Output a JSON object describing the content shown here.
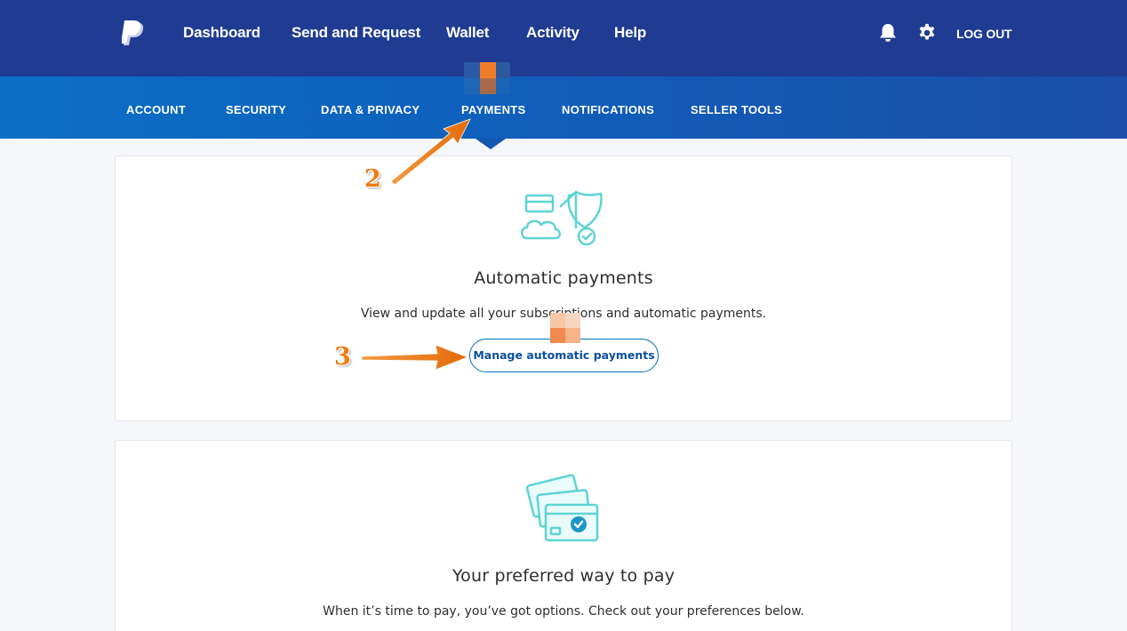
{
  "header": {
    "nav": [
      {
        "label": "Dashboard"
      },
      {
        "label": "Send and Request"
      },
      {
        "label": "Wallet"
      },
      {
        "label": "Activity"
      },
      {
        "label": "Help"
      }
    ],
    "notifications_icon": "bell-icon",
    "settings_icon": "gear-icon",
    "logout_label": "LOG OUT"
  },
  "subnav": {
    "tabs": [
      {
        "label": "ACCOUNT"
      },
      {
        "label": "SECURITY"
      },
      {
        "label": "DATA & PRIVACY"
      },
      {
        "label": "PAYMENTS",
        "active": true
      },
      {
        "label": "NOTIFICATIONS"
      },
      {
        "label": "SELLER TOOLS"
      }
    ]
  },
  "automatic_payments": {
    "icon": "cloud-shield-icon",
    "title": "Automatic payments",
    "description": "View and update all your subscriptions and automatic payments.",
    "button_label": "Manage automatic payments"
  },
  "preferred_payment": {
    "icon": "cards-check-icon",
    "title": "Your preferred way to pay",
    "description": "When it’s time to pay, you’ve got options. Check out your preferences below."
  },
  "annotations": {
    "step2": "2",
    "step3": "3"
  },
  "colors": {
    "header_bg": "#1f3b92",
    "subnav_bg": "#0f5fbb",
    "accent_orange": "#f07c11",
    "icon_teal": "#5fd3d3",
    "button_border": "#0070ba"
  }
}
